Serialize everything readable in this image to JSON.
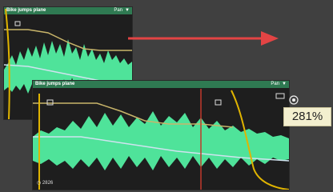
{
  "clip_top": {
    "name": "Bike jumps plane",
    "pan_label": "Pan",
    "menu_icon": "triangle-down"
  },
  "clip_bottom": {
    "name": "Bike jumps plane",
    "pan_label": "Pan",
    "menu_icon": "triangle-down",
    "timecode": "2826"
  },
  "zoom": {
    "value": "281%"
  },
  "colors": {
    "waveform": "#4fe39a",
    "titlebar": "#2f7a52",
    "volume_line": "#c9b56a",
    "pan_line": "#cfe3ef",
    "automation_yellow": "#e0b400",
    "playhead": "#e05050",
    "arrow": "#e34444"
  }
}
